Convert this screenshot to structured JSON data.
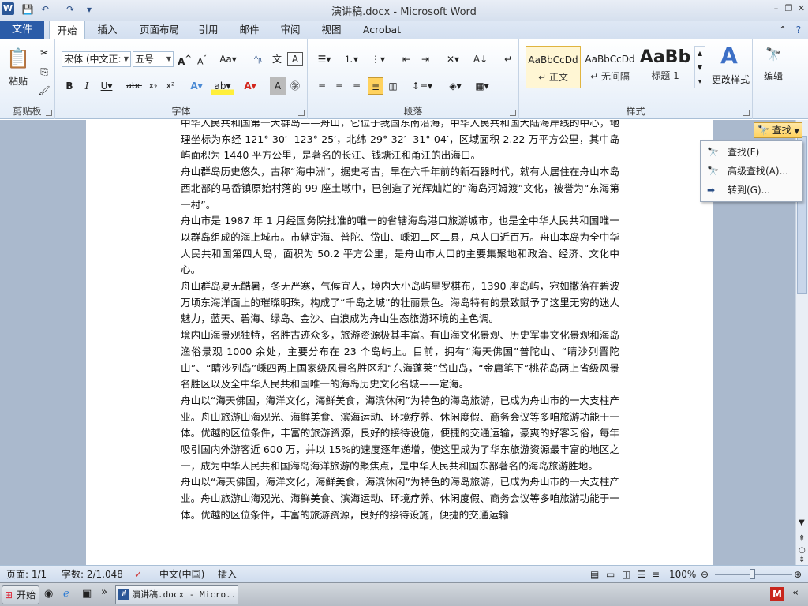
{
  "window": {
    "title": "演讲稿.docx - Microsoft Word"
  },
  "tabs": [
    "文件",
    "开始",
    "插入",
    "页面布局",
    "引用",
    "邮件",
    "审阅",
    "视图",
    "Acrobat"
  ],
  "ribbon": {
    "clipboard": {
      "paste": "粘贴",
      "group": "剪贴板"
    },
    "font": {
      "name": "宋体 (中文正:",
      "size": "五号",
      "group": "字体"
    },
    "paragraph": {
      "group": "段落"
    },
    "styles": {
      "group": "样式",
      "items": [
        {
          "preview": "AaBbCcDd",
          "label": "↵ 正文"
        },
        {
          "preview": "AaBbCcDd",
          "label": "↵ 无间隔"
        },
        {
          "preview": "AaBb",
          "label": "标题 1"
        }
      ],
      "change": "更改样式"
    },
    "editing": {
      "label": "编辑"
    }
  },
  "find": {
    "button": "查找",
    "menu": [
      "查找(F)",
      "高级查找(A)...",
      "转到(G)..."
    ]
  },
  "document": {
    "paragraphs": [
      "中华人民共和国第一大群岛——舟山，它位于我国东南沿海，中华人民共和国大陆海岸线的中心，地理坐标为东经 121° 30′ -123° 25′，北纬 29° 32′ -31° 04′，区域面积 2.22 万平方公里，其中岛屿面积为 1440 平方公里，是著名的长江、钱塘江和甬江的出海口。",
      "舟山群岛历史悠久，古称“海中洲”，据史考古，早在六千年前的新石器时代，就有人居住在舟山本岛西北部的马岙镇原始村落的 99 座土墩中，已创造了光辉灿烂的“海岛河姆渡”文化，被誉为“东海第一村”。",
      "舟山市是 1987 年 1 月经国务院批准的唯一的省辖海岛港口旅游城市，也是全中华人民共和国唯一以群岛组成的海上城市。市辖定海、普陀、岱山、嵊泗二区二县，总人口近百万。舟山本岛为全中华人民共和国第四大岛，面积为 50.2 平方公里，是舟山市人口的主要集聚地和政治、经济、文化中心。",
      "舟山群岛夏无酷暑，冬无严寒，气候宜人，境内大小岛屿星罗棋布，1390 座岛屿，宛如撒落在碧波万顷东海洋面上的璀璨明珠，构成了“千岛之城”的壮丽景色。海岛特有的景致赋予了这里无穷的迷人魅力，蓝天、碧海、绿岛、金沙、白浪成为舟山生态旅游环境的主色调。",
      "境内山海景观独特，名胜古迹众多，旅游资源极其丰富。有山海文化景观、历史军事文化景观和海岛渔俗景观 1000 余处，主要分布在 23 个岛屿上。目前，拥有“海天佛国”普陀山、“睛沙列晋陀山”、“睛沙列岛”嵊四两上国家级风景名胜区和“东海蓬莱”岱山岛，“金庸笔下”桃花岛两上省级风景名胜区以及全中华人民共和国唯一的海岛历史文化名城——定海。",
      "舟山以“海天佛国，海洋文化，海鲜美食，海滨休闲”为特色的海岛旅游，已成为舟山市的一大支柱产业。舟山旅游山海观光、海鲜美食、滨海运动、环境疗养、休闲度假、商务会议等多咱旅游功能于一体。优越的区位条件，丰富的旅游资源，良好的接待设施，便捷的交通运输，豪爽的好客习俗，每年吸引国内外游客近 600 万，并以 15%的速度逐年递增，使这里成为了华东旅游资源最丰富的地区之一，成为中华人民共和国海岛海洋旅游的聚焦点，是中华人民共和国东部著名的海岛旅游胜地。",
      "舟山以“海天佛国，海洋文化，海鲜美食，海滨休闲”为特色的海岛旅游，已成为舟山市的一大支柱产业。舟山旅游山海观光、海鲜美食、滨海运动、环境疗养、休闲度假、商务会议等多咱旅游功能于一体。优越的区位条件，丰富的旅游资源，良好的接待设施，便捷的交通运输"
    ]
  },
  "status": {
    "page": "页面: 1/1",
    "words": "字数: 2/1,048",
    "lang": "中文(中国)",
    "mode": "插入",
    "zoom": "100%"
  },
  "taskbar": {
    "start": "开始",
    "item": "演讲稿.docx - Micro..."
  }
}
